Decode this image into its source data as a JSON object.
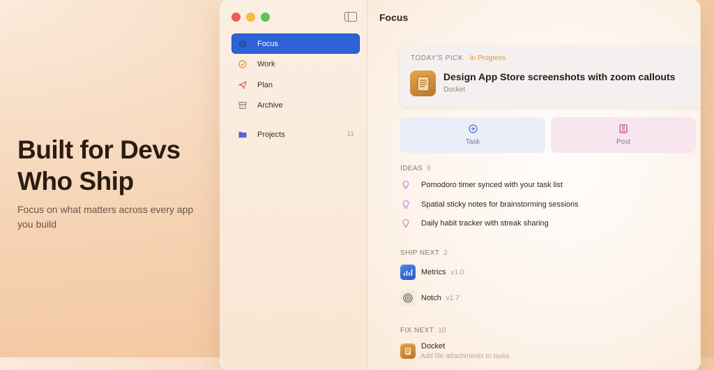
{
  "hero": {
    "title_line1": "Built for Devs",
    "title_line2": "Who Ship",
    "subtitle": "Focus on what matters across every app you build"
  },
  "colors": {
    "accent": "#2d63d6",
    "status": "#e5922d"
  },
  "sidebar": {
    "items": [
      {
        "label": "Focus",
        "icon": "focus-icon",
        "active": true
      },
      {
        "label": "Work",
        "icon": "check-circle-icon"
      },
      {
        "label": "Plan",
        "icon": "send-icon"
      },
      {
        "label": "Archive",
        "icon": "archive-box-icon"
      }
    ],
    "projects": {
      "label": "Projects",
      "count": "11",
      "icon": "folder-icon"
    }
  },
  "main": {
    "title": "Focus",
    "todays_pick": {
      "heading": "TODAY'S PICK",
      "status": "In Progress",
      "title": "Design App Store screenshots with zoom callouts",
      "app": "Docket"
    },
    "quick_actions": [
      {
        "label": "Task",
        "icon": "plus-circle-icon"
      },
      {
        "label": "Post",
        "icon": "image-post-icon"
      }
    ],
    "ideas": {
      "heading": "IDEAS",
      "count": "8",
      "items": [
        "Pomodoro timer synced with your task list",
        "Spatial sticky notes for brainstorming sessions",
        "Daily habit tracker with streak sharing"
      ]
    },
    "ship_next": {
      "heading": "SHIP NEXT",
      "count": "2",
      "items": [
        {
          "name": "Metrics",
          "version": "v1.0"
        },
        {
          "name": "Notch",
          "version": "v1.7"
        }
      ]
    },
    "fix_next": {
      "heading": "FIX NEXT",
      "count": "10",
      "items": [
        {
          "name": "Docket",
          "detail": "Add file attachments to tasks"
        }
      ]
    }
  }
}
